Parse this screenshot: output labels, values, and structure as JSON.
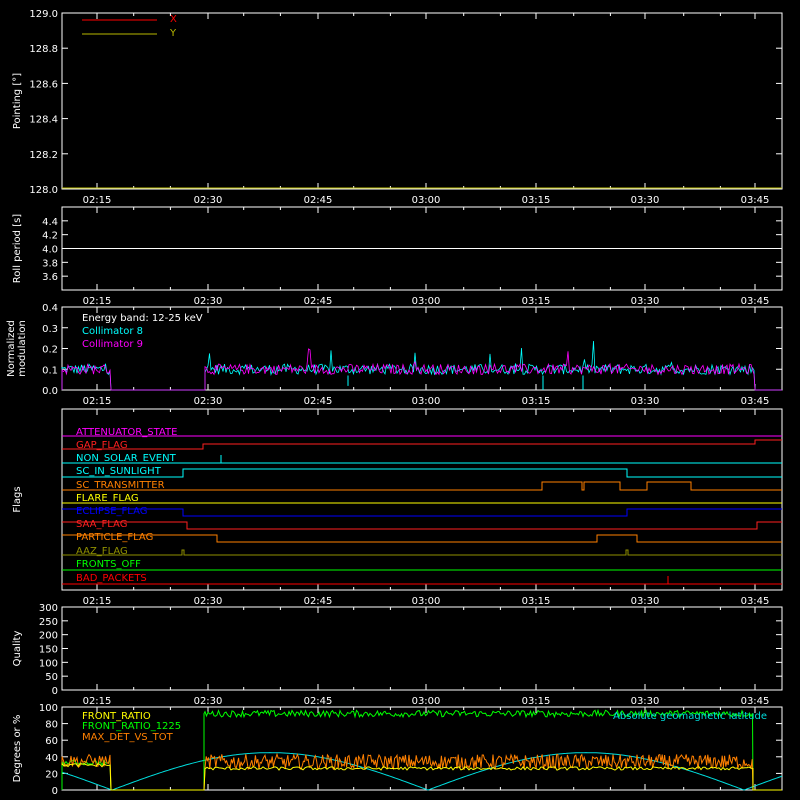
{
  "time_ticks": [
    "02:15",
    "02:30",
    "02:45",
    "03:00",
    "03:15",
    "03:30",
    "03:45"
  ],
  "chart_data": [
    {
      "type": "line",
      "ylabel": "Pointing [°]",
      "ylim": [
        128.0,
        129.0
      ],
      "ytick_labels": [
        "128.0",
        "128.2",
        "128.4",
        "128.6",
        "128.8",
        "129.0"
      ],
      "legend_placement": "top-left",
      "series": [
        {
          "name": "X",
          "color": "#ff0000",
          "values": []
        },
        {
          "name": "Y",
          "color": "#b8b800",
          "values": [
            [
              0,
              128.0
            ],
            [
              1,
              128.0
            ]
          ]
        }
      ]
    },
    {
      "type": "line",
      "ylabel": "Roll period [s]",
      "ylim": [
        3.4,
        4.6
      ],
      "ytick_labels": [
        "3.6",
        "3.8",
        "4.0",
        "4.2",
        "4.4"
      ],
      "series": [
        {
          "name": "",
          "color": "#ffffff",
          "values": [
            [
              0,
              4.0
            ],
            [
              1,
              4.0
            ]
          ]
        }
      ]
    },
    {
      "type": "line",
      "ylabel": "Normalized modulation",
      "ylim": [
        0,
        0.4
      ],
      "ytick_labels": [
        "0.0",
        "0.1",
        "0.2",
        "0.3",
        "0.4"
      ],
      "annotation": "Energy band: 12-25 keV",
      "series": [
        {
          "name": "Collimator 8",
          "color": "#00ffff",
          "mean": 0.1
        },
        {
          "name": "Collimator 9",
          "color": "#ff00ff",
          "mean": 0.1
        }
      ]
    },
    {
      "type": "line",
      "ylabel": "Flags",
      "flags": [
        {
          "name": "ATTENUATOR_STATE",
          "color": "#ff00ff"
        },
        {
          "name": "GAP_FLAG",
          "color": "#ff2020"
        },
        {
          "name": "NON_SOLAR_EVENT",
          "color": "#00ffff"
        },
        {
          "name": "SC_IN_SUNLIGHT",
          "color": "#00ffff"
        },
        {
          "name": "SC_TRANSMITTER",
          "color": "#ff8000"
        },
        {
          "name": "FLARE_FLAG",
          "color": "#ffff00"
        },
        {
          "name": "ECLIPSE_FLAG",
          "color": "#0000ff"
        },
        {
          "name": "SAA_FLAG",
          "color": "#ff2020"
        },
        {
          "name": "PARTICLE_FLAG",
          "color": "#ff8000"
        },
        {
          "name": "AAZ_FLAG",
          "color": "#909000"
        },
        {
          "name": "FRONTS_OFF",
          "color": "#00ff00"
        },
        {
          "name": "BAD_PACKETS",
          "color": "#ff0000"
        }
      ]
    },
    {
      "type": "line",
      "ylabel": "Quality",
      "ylim": [
        0,
        300
      ],
      "ytick_labels": [
        "0",
        "50",
        "100",
        "150",
        "200",
        "250",
        "300"
      ],
      "series": []
    },
    {
      "type": "line",
      "ylabel": "Degrees or %",
      "ylim": [
        0,
        100
      ],
      "ytick_labels": [
        "0",
        "20",
        "40",
        "60",
        "80",
        "100"
      ],
      "series": [
        {
          "name": "FRONT_RATIO",
          "color": "#ffff00",
          "mean": 28
        },
        {
          "name": "FRONT_RATIO_1225",
          "color": "#00ff00",
          "mean": 92
        },
        {
          "name": "MAX_DET_VS_TOT",
          "color": "#ff8000",
          "mean": 33
        },
        {
          "name": "Absolute geomagnetic latitude",
          "color": "#00dddd",
          "max": 45
        }
      ]
    }
  ]
}
